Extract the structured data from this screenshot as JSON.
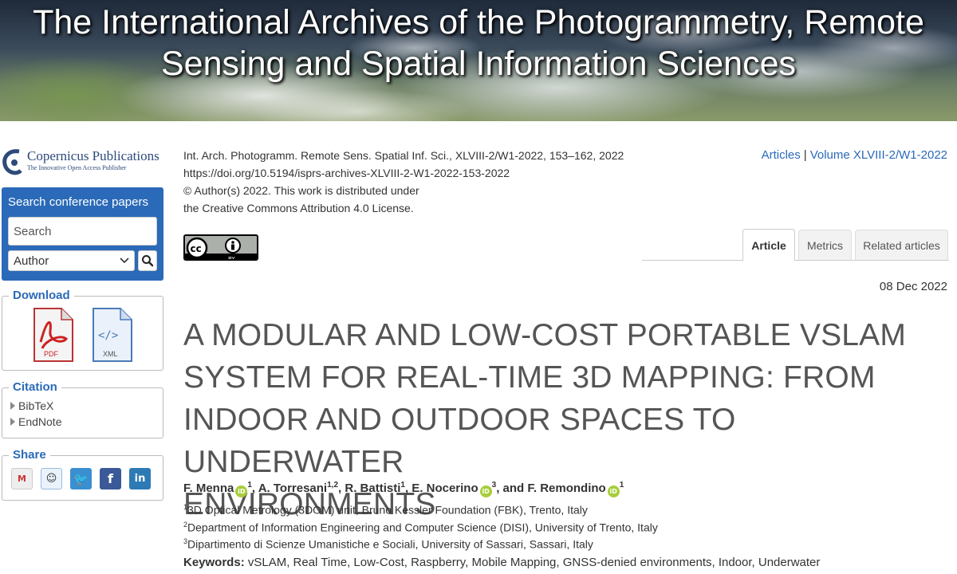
{
  "banner": {
    "title_line1": "The International Archives of the Photogrammetry, Remote",
    "title_line2": "Sensing and Spatial Information Sciences"
  },
  "publisher": {
    "name": "Copernicus Publications",
    "tagline": "The Innovative Open Access Publisher"
  },
  "search": {
    "heading": "Search conference papers",
    "placeholder": "Search",
    "field_selected": "Author"
  },
  "download": {
    "heading": "Download",
    "pdf_label": "PDF",
    "xml_label": "XML"
  },
  "citation": {
    "heading": "Citation",
    "items": [
      "BibTeX",
      "EndNote"
    ]
  },
  "share": {
    "heading": "Share"
  },
  "meta": {
    "line1": "Int. Arch. Photogramm. Remote Sens. Spatial Inf. Sci., XLVIII-2/W1-2022, 153–162, 2022",
    "line2": "https://doi.org/10.5194/isprs-archives-XLVIII-2-W1-2022-153-2022",
    "line3": "© Author(s) 2022. This work is distributed under",
    "line4": "the Creative Commons Attribution 4.0 License."
  },
  "breadcrumbs": {
    "articles": "Articles",
    "separator": "|",
    "volume": "Volume XLVIII-2/W1-2022"
  },
  "license_badge": {
    "cc": "cc",
    "by": "BY"
  },
  "tabs": [
    "Article",
    "Metrics",
    "Related articles"
  ],
  "article": {
    "date": "08 Dec 2022",
    "title_lines": [
      "A MODULAR AND LOW-COST PORTABLE VSLAM",
      "SYSTEM FOR REAL-TIME 3D MAPPING: FROM",
      "INDOOR AND OUTDOOR SPACES TO UNDERWATER",
      "ENVIRONMENTS"
    ],
    "authors": [
      {
        "name": "F. Menna",
        "sup": "1",
        "orcid": true,
        "prefix": ""
      },
      {
        "name": "A. Torresani",
        "sup": "1,2",
        "orcid": false,
        "prefix": ", "
      },
      {
        "name": "R. Battisti",
        "sup": "1",
        "orcid": false,
        "prefix": ", "
      },
      {
        "name": "E. Nocerino",
        "sup": "3",
        "orcid": true,
        "prefix": ", "
      },
      {
        "name": "F. Remondino",
        "sup": "1",
        "orcid": true,
        "prefix": ", and "
      }
    ],
    "affiliations": [
      {
        "sup": "1",
        "text": "3D Optical Metrology (3DOM) unit, Bruno Kessler Foundation (FBK), Trento, Italy"
      },
      {
        "sup": "2",
        "text": "Department of Information Engineering and Computer Science (DISI), University of Trento, Italy"
      },
      {
        "sup": "3",
        "text": "Dipartimento di Scienze Umanistiche e Sociali, University of Sassari, Sassari, Italy"
      }
    ],
    "keywords_label": "Keywords:",
    "keywords": "vSLAM, Real Time, Low-Cost, Raspberry, Mobile Mapping, GNSS-denied environments, Indoor, Underwater"
  },
  "colors": {
    "brand_blue": "#2a6ab8",
    "orcid_green": "#a6ce39"
  }
}
